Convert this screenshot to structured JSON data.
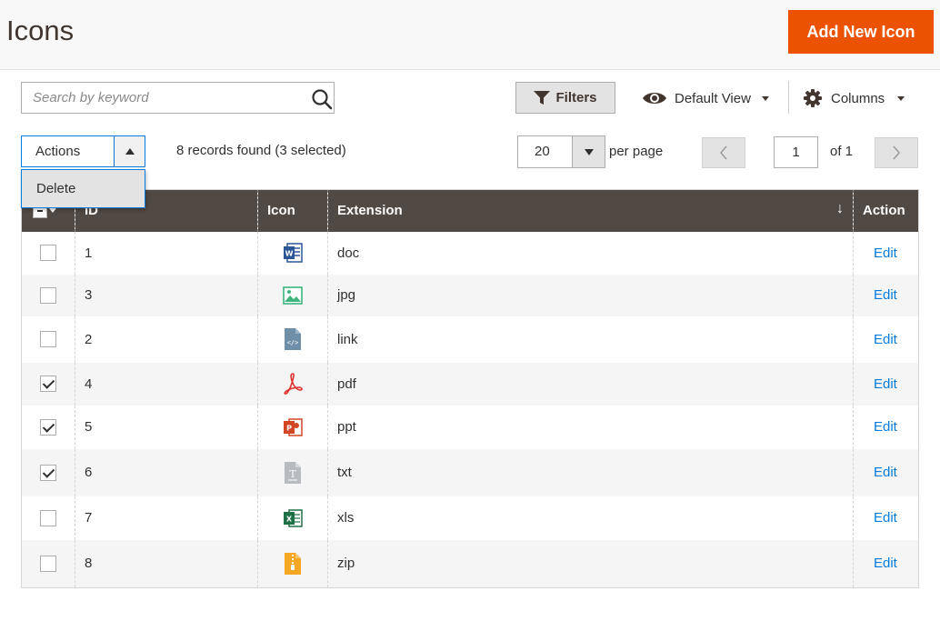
{
  "header": {
    "title": "Icons",
    "add_button_label": "Add New Icon"
  },
  "toolbar": {
    "search_placeholder": "Search by keyword",
    "filters_label": "Filters",
    "view_label": "Default View",
    "columns_label": "Columns"
  },
  "actions": {
    "label": "Actions",
    "menu": [
      "Delete"
    ]
  },
  "records_found": "8 records found (3 selected)",
  "pager": {
    "per_page_value": "20",
    "per_page_label": "per page",
    "current_page": "1",
    "total_label": "of 1"
  },
  "grid": {
    "columns": [
      "ID",
      "Icon",
      "Extension",
      "Action"
    ],
    "sort_indicator": "↓",
    "rows": [
      {
        "id": "1",
        "extension": "doc",
        "icon": "word-doc-icon",
        "checked": false,
        "action": "Edit"
      },
      {
        "id": "3",
        "extension": "jpg",
        "icon": "image-icon",
        "checked": false,
        "action": "Edit"
      },
      {
        "id": "2",
        "extension": "link",
        "icon": "code-file-icon",
        "checked": false,
        "action": "Edit"
      },
      {
        "id": "4",
        "extension": "pdf",
        "icon": "pdf-icon",
        "checked": true,
        "action": "Edit"
      },
      {
        "id": "5",
        "extension": "ppt",
        "icon": "powerpoint-icon",
        "checked": true,
        "action": "Edit"
      },
      {
        "id": "6",
        "extension": "txt",
        "icon": "text-file-icon",
        "checked": true,
        "action": "Edit"
      },
      {
        "id": "7",
        "extension": "xls",
        "icon": "excel-icon",
        "checked": false,
        "action": "Edit"
      },
      {
        "id": "8",
        "extension": "zip",
        "icon": "zip-archive-icon",
        "checked": false,
        "action": "Edit"
      }
    ]
  },
  "colors": {
    "accent": "#eb5202",
    "header_bg": "#514943",
    "link": "#007bdb"
  }
}
